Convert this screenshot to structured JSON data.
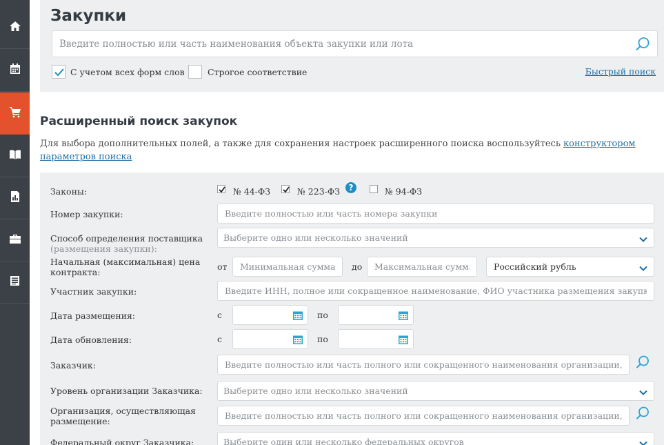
{
  "sidebar": {
    "items": [
      {
        "icon": "home-icon"
      },
      {
        "icon": "calendar-icon"
      },
      {
        "icon": "cart-icon",
        "active": true
      },
      {
        "icon": "book-icon"
      },
      {
        "icon": "report-icon"
      },
      {
        "icon": "briefcase-icon"
      },
      {
        "icon": "document-icon"
      }
    ]
  },
  "header": {
    "title": "Закупки",
    "search_placeholder": "Введите полностью или часть наименования объекта закупки или лота",
    "option_word_forms": "С учетом всех форм слов",
    "option_strict": "Строгое соответствие",
    "quick_search_link": "Быстрый поиск"
  },
  "advanced": {
    "title": "Расширенный поиск закупок",
    "desc_text": "Для выбора дополнительных полей, а также для сохранения настроек расширенного поиска воспользуйтесь ",
    "desc_link": "конструктором параметров поиска"
  },
  "form": {
    "laws_label": "Законы:",
    "law_44": "№ 44-ФЗ",
    "law_223": "№ 223-ФЗ",
    "law_94": "№ 94-ФЗ",
    "help": "?",
    "number_label": "Номер закупки:",
    "number_placeholder": "Введите полностью или часть номера закупки",
    "method_label": "Способ определения поставщика",
    "method_label_sub": "(размещения закупки):",
    "method_placeholder": "Выберите одно или несколько значений",
    "price_label_1": "Начальная (максимальная) цена",
    "price_label_2": "контракта:",
    "price_from": "от",
    "price_min_placeholder": "Минимальная сумма",
    "price_to": "до",
    "price_max_placeholder": "Максимальная сумма",
    "currency": "Российский рубль",
    "participant_label": "Участник закупки:",
    "participant_placeholder": "Введите ИНН, полное или сокращенное наименование, ФИО участника размещения закупки",
    "pub_date_label": "Дата размещения:",
    "upd_date_label": "Дата обновления:",
    "date_from": "с",
    "date_to": "по",
    "customer_label": "Заказчик:",
    "customer_placeholder": "Введите полностью или часть полного или сокращенного наименования организации, ИНН",
    "customer_level_label": "Уровень организации Заказчика:",
    "customer_level_placeholder": "Выберите одно или несколько значений",
    "placing_org_label_1": "Организация, осуществляющая",
    "placing_org_label_2": "размещение:",
    "placing_org_placeholder": "Введите полностью или часть полного или сокращенного наименования организации, ИНН",
    "district_label": "Федеральный округ Заказчика:",
    "district_placeholder": "Выберите один или несколько федеральных округов"
  }
}
